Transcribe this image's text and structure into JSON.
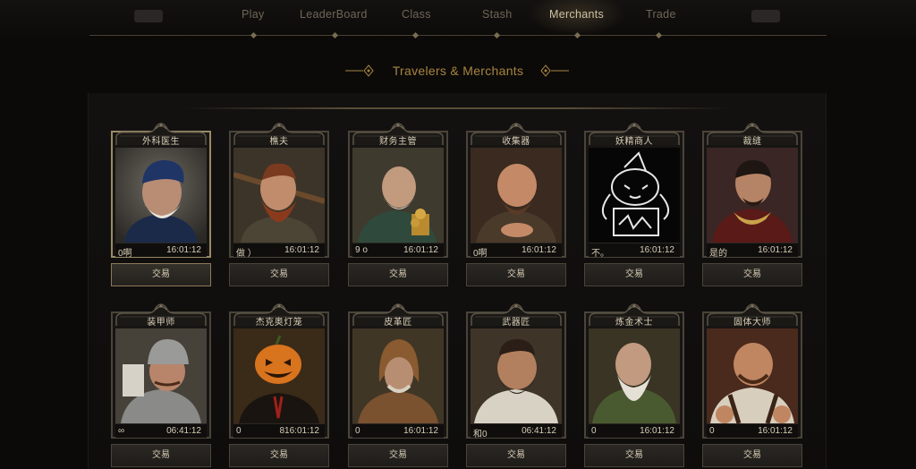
{
  "nav": {
    "items": [
      {
        "label": "Play",
        "active": false
      },
      {
        "label": "LeaderBoard",
        "active": false
      },
      {
        "label": "Class",
        "active": false
      },
      {
        "label": "Stash",
        "active": false
      },
      {
        "label": "Merchants",
        "active": true
      },
      {
        "label": "Trade",
        "active": false
      }
    ]
  },
  "section": {
    "title": "Travelers & Merchants"
  },
  "colors": {
    "accent": "#a8843e",
    "frame": "#4a4439",
    "selected_frame": "#9a8a66",
    "background": "#0b0a09"
  },
  "merchants": [
    {
      "name": "外科医生",
      "count": "0啊",
      "timer": "16:01:12",
      "trade_label": "交易",
      "selected": true,
      "portrait_icon": "surgeon-portrait"
    },
    {
      "name": "樵夫",
      "count": "做 ）",
      "timer": "16:01:12",
      "trade_label": "交易",
      "selected": false,
      "portrait_icon": "woodsman-portrait"
    },
    {
      "name": "财务主管",
      "count": "9 o",
      "timer": "16:01:12",
      "trade_label": "交易",
      "selected": false,
      "portrait_icon": "treasurer-portrait"
    },
    {
      "name": "收集器",
      "count": "0啊",
      "timer": "16:01:12",
      "trade_label": "交易",
      "selected": false,
      "portrait_icon": "collector-portrait"
    },
    {
      "name": "妖精商人",
      "count": "不。",
      "timer": "16:01:12",
      "trade_label": "交易",
      "selected": false,
      "portrait_icon": "goblin-merchant-sketch"
    },
    {
      "name": "裁缝",
      "count": "是的",
      "timer": "16:01:12",
      "trade_label": "交易",
      "selected": false,
      "portrait_icon": "tailor-portrait"
    },
    {
      "name": "装甲师",
      "count": "∞",
      "timer": "06:41:12",
      "trade_label": "交易",
      "selected": false,
      "portrait_icon": "armourer-portrait"
    },
    {
      "name": "杰克奥灯笼",
      "count": "0",
      "timer": "816:01:12",
      "trade_label": "交易",
      "selected": false,
      "portrait_icon": "jack-o-lantern-portrait"
    },
    {
      "name": "皮革匠",
      "count": "0",
      "timer": "16:01:12",
      "trade_label": "交易",
      "selected": false,
      "portrait_icon": "leathersmith-portrait"
    },
    {
      "name": "武器匠",
      "count": "和0",
      "timer": "06:41:12",
      "trade_label": "交易",
      "selected": false,
      "portrait_icon": "weaponsmith-portrait"
    },
    {
      "name": "炼金术士",
      "count": "0",
      "timer": "16:01:12",
      "trade_label": "交易",
      "selected": false,
      "portrait_icon": "alchemist-portrait"
    },
    {
      "name": "固体大师",
      "count": "0",
      "timer": "16:01:12",
      "trade_label": "交易",
      "selected": false,
      "portrait_icon": "tavern-master-portrait"
    }
  ]
}
